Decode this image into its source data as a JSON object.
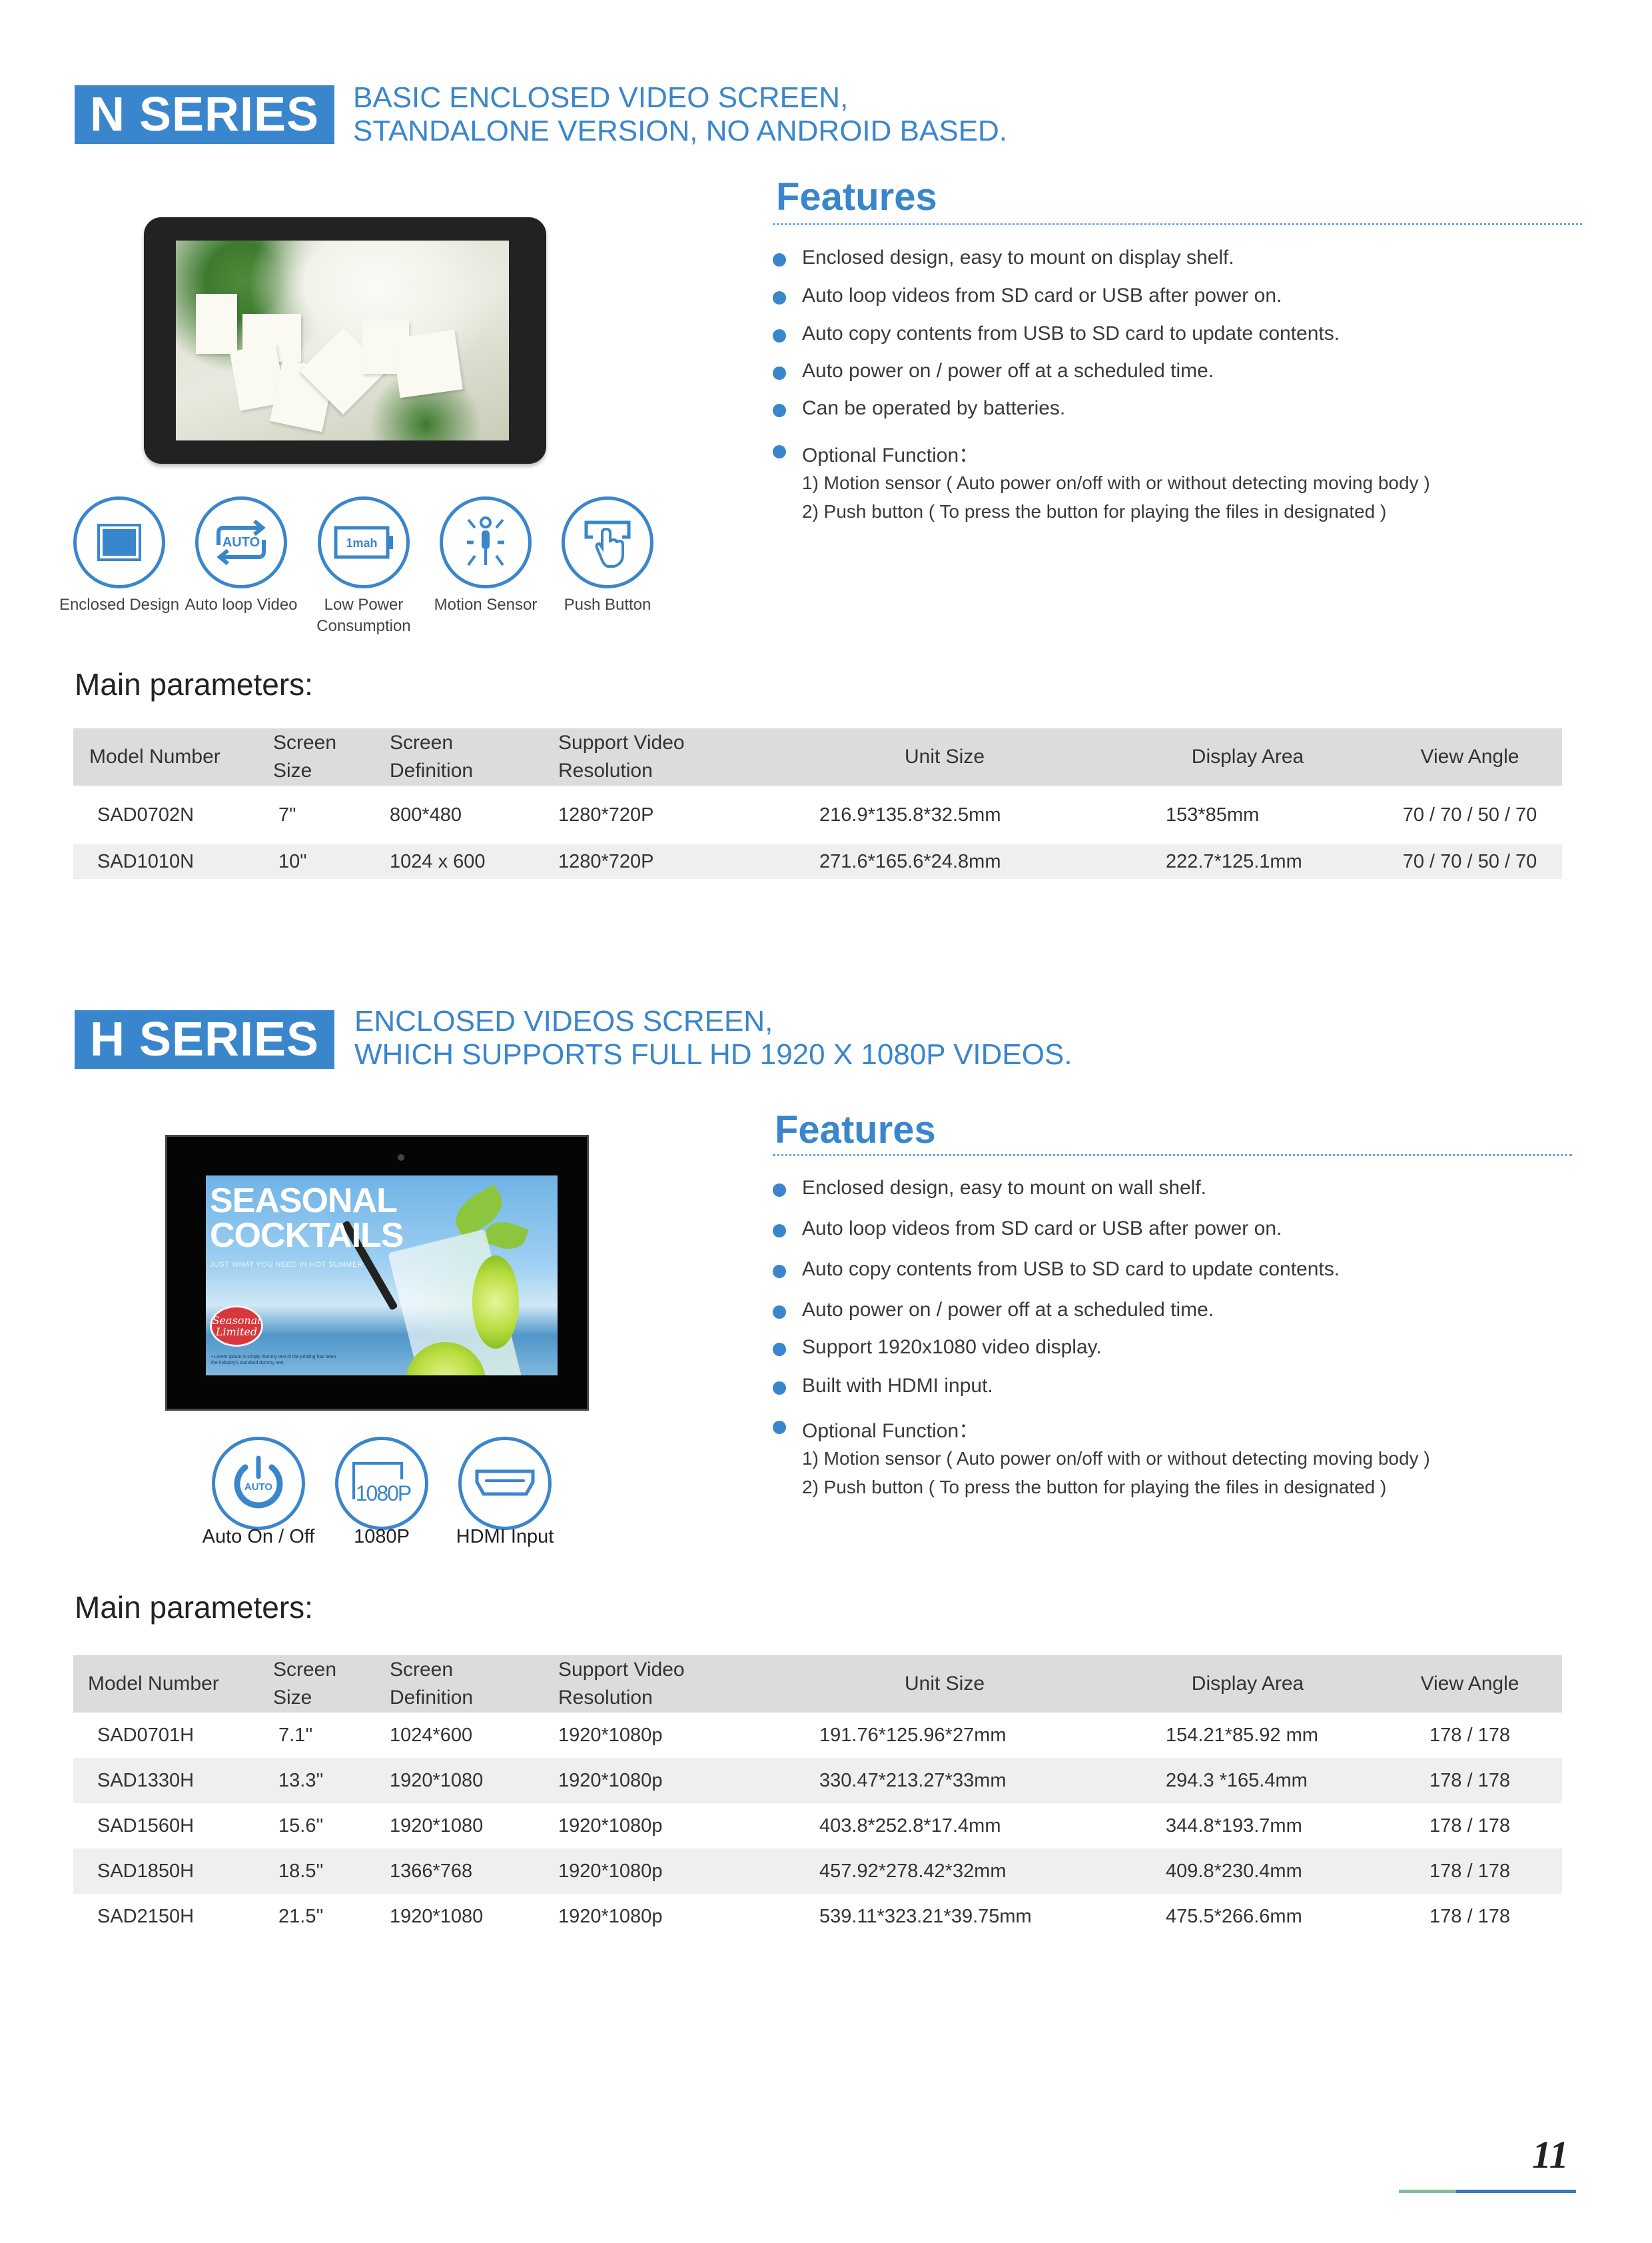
{
  "n_series": {
    "badge": "N SERIES",
    "subtitle_line1": "BASIC ENCLOSED VIDEO SCREEN,",
    "subtitle_line2": "STANDALONE VERSION, NO ANDROID BASED.",
    "features_title": "Features",
    "features": [
      "Enclosed design, easy to mount on display shelf.",
      "Auto loop videos from SD card or USB after power on.",
      "Auto copy contents from USB to SD card to update contents.",
      "Auto power on / power off at a scheduled time.",
      "Can be operated by batteries.",
      "Optional Function："
    ],
    "optional": [
      "1) Motion sensor ( Auto power on/off with or without detecting moving body )",
      "2) Push button ( To press the button for playing the files in designated )"
    ],
    "icons": [
      {
        "name": "enclosed-design-icon",
        "label": "Enclosed Design"
      },
      {
        "name": "auto-loop-video-icon",
        "label": "Auto loop Video",
        "glyph": "AUTO"
      },
      {
        "name": "low-power-icon",
        "label_line1": "Low Power",
        "label_line2": "Consumption",
        "glyph": "1mah"
      },
      {
        "name": "motion-sensor-icon",
        "label": "Motion Sensor"
      },
      {
        "name": "push-button-icon",
        "label": "Push Button"
      }
    ],
    "params_title": "Main parameters:",
    "table": {
      "headers": [
        {
          "line1": "Model Number",
          "line2": ""
        },
        {
          "line1": "Screen",
          "line2": "Size"
        },
        {
          "line1": "Screen",
          "line2": "Definition"
        },
        {
          "line1": "Support Video",
          "line2": "Resolution"
        },
        {
          "line1": "Unit Size",
          "line2": ""
        },
        {
          "line1": "Display Area",
          "line2": ""
        },
        {
          "line1": "View Angle",
          "line2": ""
        }
      ],
      "rows": [
        [
          "SAD0702N",
          "7\"",
          "800*480",
          "1280*720P",
          "216.9*135.8*32.5mm",
          "153*85mm",
          "70 / 70 / 50 / 70"
        ],
        [
          "SAD1010N",
          "10\"",
          "1024 x 600",
          "1280*720P",
          "271.6*165.6*24.8mm",
          "222.7*125.1mm",
          "70 / 70 / 50 / 70"
        ]
      ]
    }
  },
  "h_series": {
    "badge": "H SERIES",
    "subtitle_line1": "ENCLOSED VIDEOS SCREEN,",
    "subtitle_line2": "WHICH SUPPORTS FULL HD 1920 X 1080P VIDEOS.",
    "features_title": "Features",
    "features": [
      "Enclosed design, easy to mount on wall shelf.",
      "Auto loop videos from SD card or USB after power on.",
      "Auto copy contents from USB to SD card to update contents.",
      "Auto power on / power off at a scheduled time.",
      "Support 1920x1080 video display.",
      "Built with HDMI input.",
      "Optional Function："
    ],
    "optional": [
      "1) Motion sensor ( Auto power on/off with or without detecting moving body )",
      "2) Push button ( To press the button for playing the files in designated )"
    ],
    "screen_promo": {
      "title_line1": "SEASONAL",
      "title_line2": "COCKTAILS",
      "tagline": "JUST WHAT YOU NEED IN HOT SUMMER",
      "badge_line1": "Seasonal",
      "badge_line2": "Limited",
      "footnote": "• Lorem Ipsum is simply dummy text of the printing has been the industry's standard dummy text."
    },
    "icons": [
      {
        "name": "auto-on-off-icon",
        "label": "Auto On / Off",
        "glyph": "AUTO"
      },
      {
        "name": "1080p-icon",
        "label": "1080P",
        "glyph": "1080P"
      },
      {
        "name": "hdmi-input-icon",
        "label": "HDMI Input"
      }
    ],
    "params_title": "Main parameters:",
    "table": {
      "headers": [
        {
          "line1": "Model Number",
          "line2": ""
        },
        {
          "line1": "Screen",
          "line2": "Size"
        },
        {
          "line1": "Screen",
          "line2": "Definition"
        },
        {
          "line1": "Support Video",
          "line2": "Resolution"
        },
        {
          "line1": "Unit Size",
          "line2": ""
        },
        {
          "line1": "Display Area",
          "line2": ""
        },
        {
          "line1": "View Angle",
          "line2": ""
        }
      ],
      "rows": [
        [
          "SAD0701H",
          "7.1''",
          "1024*600",
          "1920*1080p",
          "191.76*125.96*27mm",
          "154.21*85.92 mm",
          "178 / 178"
        ],
        [
          "SAD1330H",
          "13.3''",
          "1920*1080",
          "1920*1080p",
          "330.47*213.27*33mm",
          "294.3 *165.4mm",
          "178 / 178"
        ],
        [
          "SAD1560H",
          "15.6''",
          "1920*1080",
          "1920*1080p",
          "403.8*252.8*17.4mm",
          "344.8*193.7mm",
          "178 / 178"
        ],
        [
          "SAD1850H",
          "18.5''",
          "1366*768",
          "1920*1080p",
          "457.92*278.42*32mm",
          "409.8*230.4mm",
          "178 / 178"
        ],
        [
          "SAD2150H",
          "21.5''",
          "1920*1080",
          "1920*1080p",
          "539.11*323.21*39.75mm",
          "475.5*266.6mm",
          "178 / 178"
        ]
      ]
    }
  },
  "footer": {
    "page_number": "11"
  },
  "colors": {
    "brand_blue": "#3a86cc",
    "table_header": "#dcdcdc",
    "row_alt": "#efefef",
    "footer_green": "#7fbf9a"
  }
}
